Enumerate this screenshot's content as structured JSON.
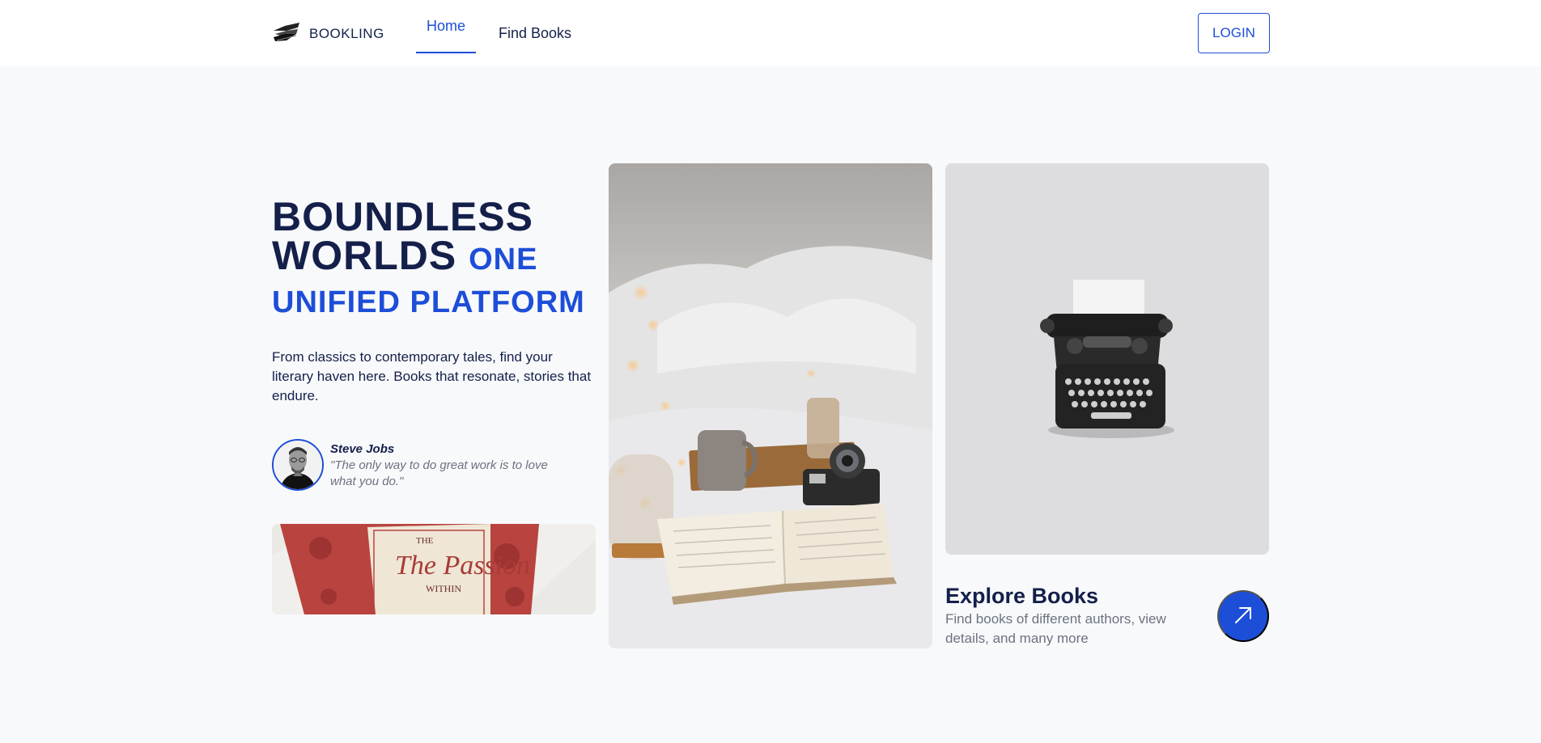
{
  "brand": {
    "name": "BOOKLING",
    "logo_icon": "book-logo-icon"
  },
  "nav": {
    "home": "Home",
    "find_books": "Find Books",
    "login": "LOGIN"
  },
  "hero": {
    "title_line1": "BOUNDLESS",
    "title_line2": "WORLDS",
    "title_accent1": "ONE",
    "title_accent2": "UNIFIED PLATFORM",
    "description": "From classics to contemporary tales, find your literary haven here. Books that resonate, stories that endure."
  },
  "quote": {
    "author": "Steve Jobs",
    "text": "\"The only way to do great work is to love what you do.\""
  },
  "images": {
    "small_book_title": "The Passion",
    "small_book_subtitle": "WITHIN"
  },
  "explore": {
    "title": "Explore Books",
    "description": "Find books of different authors, view details, and many more",
    "button_icon": "arrow-up-right-icon"
  },
  "colors": {
    "accent": "#1d4ed8",
    "dark": "#14204a",
    "muted": "#6b7280",
    "background": "#f8f9fb"
  }
}
